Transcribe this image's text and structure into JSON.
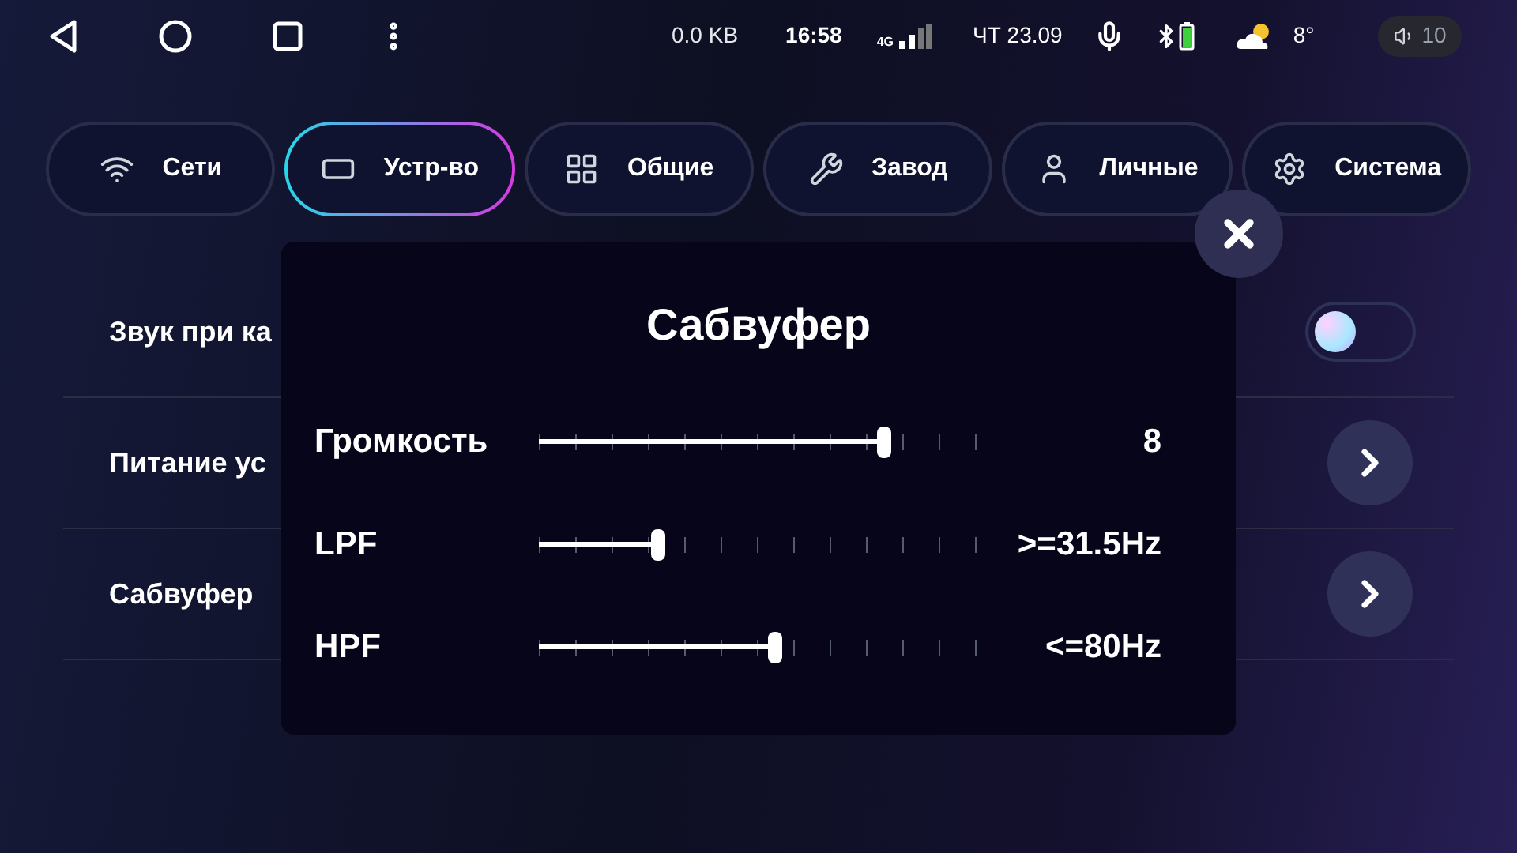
{
  "status_bar": {
    "data_rate": "0.0 KB",
    "time": "16:58",
    "network": "4G",
    "date": "ЧТ 23.09",
    "temperature": "8°",
    "volume": "10"
  },
  "tabs": [
    {
      "label": "Сети",
      "kind": "wifi",
      "selected": false
    },
    {
      "label": "Устр-во",
      "kind": "device",
      "selected": true
    },
    {
      "label": "Общие",
      "kind": "grid",
      "selected": false
    },
    {
      "label": "Завод",
      "kind": "tools",
      "selected": false
    },
    {
      "label": "Личные",
      "kind": "user",
      "selected": false
    },
    {
      "label": "Система",
      "kind": "gear",
      "selected": false
    }
  ],
  "rows": [
    {
      "label": "Звук при ка",
      "kind": "toggle",
      "on": false
    },
    {
      "label": "Питание ус",
      "kind": "link"
    },
    {
      "label": "Сабвуфер",
      "kind": "link"
    }
  ],
  "dialog": {
    "title": "Сабвуфер",
    "sliders": [
      {
        "label": "Громкость",
        "level": 0.79,
        "reading": "8"
      },
      {
        "label": "LPF",
        "level": 0.27,
        "reading": ">=31.5Hz"
      },
      {
        "label": "HPF",
        "level": 0.54,
        "reading": "<=80Hz"
      }
    ]
  }
}
